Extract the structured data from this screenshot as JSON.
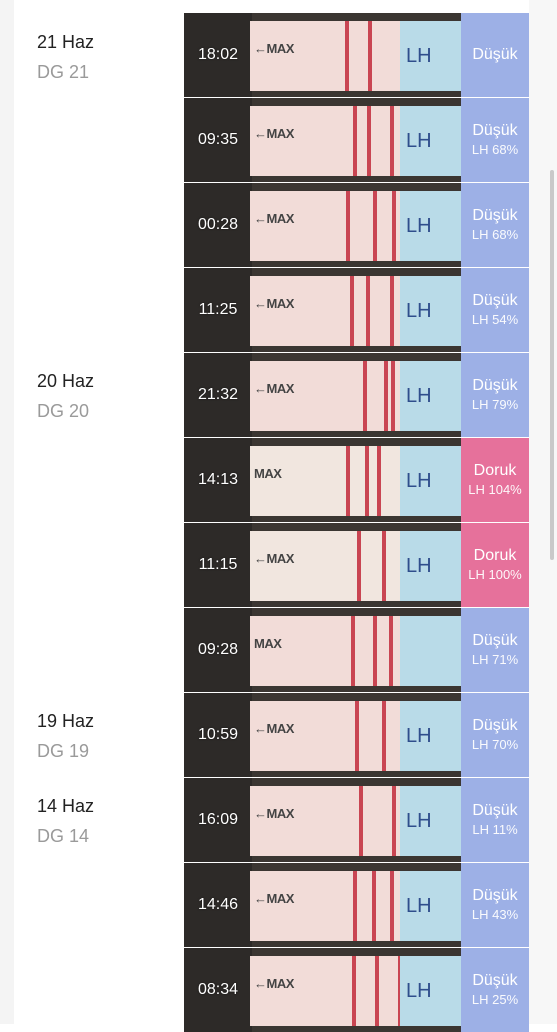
{
  "colors": {
    "low": "#9db0e6",
    "peak": "#e6719b",
    "test_band": "#c94552"
  },
  "groups": [
    {
      "date": "21 Haz",
      "cycle_day": "DG 21"
    },
    {
      "date": "20 Haz",
      "cycle_day": "DG 20"
    },
    {
      "date": "19 Haz",
      "cycle_day": "DG 19"
    },
    {
      "date": "14 Haz",
      "cycle_day": "DG 14"
    }
  ],
  "tests": [
    {
      "time": "18:02",
      "status": "Düşük",
      "lh": "",
      "level": "low",
      "max_label": "←MAX",
      "lh_label": "LH"
    },
    {
      "time": "09:35",
      "status": "Düşük",
      "lh": "LH 68%",
      "level": "low",
      "max_label": "←MAX",
      "lh_label": "LH"
    },
    {
      "time": "00:28",
      "status": "Düşük",
      "lh": "LH 68%",
      "level": "low",
      "max_label": "←MAX",
      "lh_label": "LH"
    },
    {
      "time": "11:25",
      "status": "Düşük",
      "lh": "LH 54%",
      "level": "low",
      "max_label": "←MAX",
      "lh_label": "LH"
    },
    {
      "time": "21:32",
      "status": "Düşük",
      "lh": "LH 79%",
      "level": "low",
      "max_label": "←MAX",
      "lh_label": "LH"
    },
    {
      "time": "14:13",
      "status": "Doruk",
      "lh": "LH 104%",
      "level": "peak",
      "max_label": "MAX",
      "lh_label": "LH"
    },
    {
      "time": "11:15",
      "status": "Doruk",
      "lh": "LH 100%",
      "level": "peak",
      "max_label": "←MAX",
      "lh_label": "LH"
    },
    {
      "time": "09:28",
      "status": "Düşük",
      "lh": "LH 71%",
      "level": "low",
      "max_label": "MAX",
      "lh_label": ""
    },
    {
      "time": "10:59",
      "status": "Düşük",
      "lh": "LH 70%",
      "level": "low",
      "max_label": "←MAX",
      "lh_label": "LH"
    },
    {
      "time": "16:09",
      "status": "Düşük",
      "lh": "LH 11%",
      "level": "low",
      "max_label": "←MAX",
      "lh_label": "LH"
    },
    {
      "time": "14:46",
      "status": "Düşük",
      "lh": "LH 43%",
      "level": "low",
      "max_label": "←MAX",
      "lh_label": "LH"
    },
    {
      "time": "08:34",
      "status": "Düşük",
      "lh": "LH 25%",
      "level": "low",
      "max_label": "←MAX",
      "lh_label": "LH"
    }
  ]
}
